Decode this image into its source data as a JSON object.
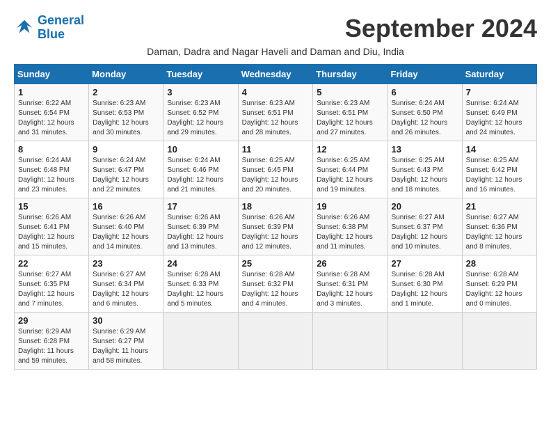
{
  "logo": {
    "line1": "General",
    "line2": "Blue"
  },
  "title": "September 2024",
  "subtitle": "Daman, Dadra and Nagar Haveli and Daman and Diu, India",
  "days_of_week": [
    "Sunday",
    "Monday",
    "Tuesday",
    "Wednesday",
    "Thursday",
    "Friday",
    "Saturday"
  ],
  "weeks": [
    [
      {
        "day": "1",
        "content": "Sunrise: 6:22 AM\nSunset: 6:54 PM\nDaylight: 12 hours and 31 minutes."
      },
      {
        "day": "2",
        "content": "Sunrise: 6:23 AM\nSunset: 6:53 PM\nDaylight: 12 hours and 30 minutes."
      },
      {
        "day": "3",
        "content": "Sunrise: 6:23 AM\nSunset: 6:52 PM\nDaylight: 12 hours and 29 minutes."
      },
      {
        "day": "4",
        "content": "Sunrise: 6:23 AM\nSunset: 6:51 PM\nDaylight: 12 hours and 28 minutes."
      },
      {
        "day": "5",
        "content": "Sunrise: 6:23 AM\nSunset: 6:51 PM\nDaylight: 12 hours and 27 minutes."
      },
      {
        "day": "6",
        "content": "Sunrise: 6:24 AM\nSunset: 6:50 PM\nDaylight: 12 hours and 26 minutes."
      },
      {
        "day": "7",
        "content": "Sunrise: 6:24 AM\nSunset: 6:49 PM\nDaylight: 12 hours and 24 minutes."
      }
    ],
    [
      {
        "day": "8",
        "content": "Sunrise: 6:24 AM\nSunset: 6:48 PM\nDaylight: 12 hours and 23 minutes."
      },
      {
        "day": "9",
        "content": "Sunrise: 6:24 AM\nSunset: 6:47 PM\nDaylight: 12 hours and 22 minutes."
      },
      {
        "day": "10",
        "content": "Sunrise: 6:24 AM\nSunset: 6:46 PM\nDaylight: 12 hours and 21 minutes."
      },
      {
        "day": "11",
        "content": "Sunrise: 6:25 AM\nSunset: 6:45 PM\nDaylight: 12 hours and 20 minutes."
      },
      {
        "day": "12",
        "content": "Sunrise: 6:25 AM\nSunset: 6:44 PM\nDaylight: 12 hours and 19 minutes."
      },
      {
        "day": "13",
        "content": "Sunrise: 6:25 AM\nSunset: 6:43 PM\nDaylight: 12 hours and 18 minutes."
      },
      {
        "day": "14",
        "content": "Sunrise: 6:25 AM\nSunset: 6:42 PM\nDaylight: 12 hours and 16 minutes."
      }
    ],
    [
      {
        "day": "15",
        "content": "Sunrise: 6:26 AM\nSunset: 6:41 PM\nDaylight: 12 hours and 15 minutes."
      },
      {
        "day": "16",
        "content": "Sunrise: 6:26 AM\nSunset: 6:40 PM\nDaylight: 12 hours and 14 minutes."
      },
      {
        "day": "17",
        "content": "Sunrise: 6:26 AM\nSunset: 6:39 PM\nDaylight: 12 hours and 13 minutes."
      },
      {
        "day": "18",
        "content": "Sunrise: 6:26 AM\nSunset: 6:39 PM\nDaylight: 12 hours and 12 minutes."
      },
      {
        "day": "19",
        "content": "Sunrise: 6:26 AM\nSunset: 6:38 PM\nDaylight: 12 hours and 11 minutes."
      },
      {
        "day": "20",
        "content": "Sunrise: 6:27 AM\nSunset: 6:37 PM\nDaylight: 12 hours and 10 minutes."
      },
      {
        "day": "21",
        "content": "Sunrise: 6:27 AM\nSunset: 6:36 PM\nDaylight: 12 hours and 8 minutes."
      }
    ],
    [
      {
        "day": "22",
        "content": "Sunrise: 6:27 AM\nSunset: 6:35 PM\nDaylight: 12 hours and 7 minutes."
      },
      {
        "day": "23",
        "content": "Sunrise: 6:27 AM\nSunset: 6:34 PM\nDaylight: 12 hours and 6 minutes."
      },
      {
        "day": "24",
        "content": "Sunrise: 6:28 AM\nSunset: 6:33 PM\nDaylight: 12 hours and 5 minutes."
      },
      {
        "day": "25",
        "content": "Sunrise: 6:28 AM\nSunset: 6:32 PM\nDaylight: 12 hours and 4 minutes."
      },
      {
        "day": "26",
        "content": "Sunrise: 6:28 AM\nSunset: 6:31 PM\nDaylight: 12 hours and 3 minutes."
      },
      {
        "day": "27",
        "content": "Sunrise: 6:28 AM\nSunset: 6:30 PM\nDaylight: 12 hours and 1 minute."
      },
      {
        "day": "28",
        "content": "Sunrise: 6:28 AM\nSunset: 6:29 PM\nDaylight: 12 hours and 0 minutes."
      }
    ],
    [
      {
        "day": "29",
        "content": "Sunrise: 6:29 AM\nSunset: 6:28 PM\nDaylight: 11 hours and 59 minutes."
      },
      {
        "day": "30",
        "content": "Sunrise: 6:29 AM\nSunset: 6:27 PM\nDaylight: 11 hours and 58 minutes."
      },
      {
        "day": "",
        "content": ""
      },
      {
        "day": "",
        "content": ""
      },
      {
        "day": "",
        "content": ""
      },
      {
        "day": "",
        "content": ""
      },
      {
        "day": "",
        "content": ""
      }
    ]
  ]
}
